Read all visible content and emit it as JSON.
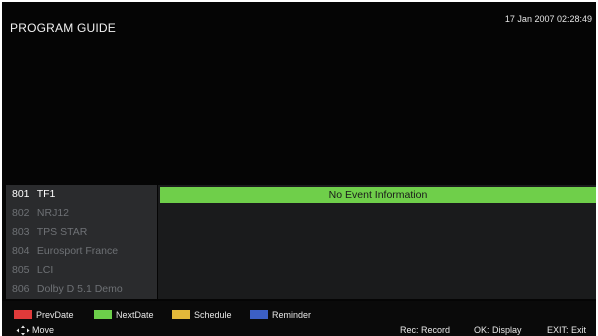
{
  "header": {
    "title": "PROGRAM GUIDE",
    "datetime": "17 Jan 2007 02:28:49"
  },
  "channels": [
    {
      "number": "801",
      "name": "TF1",
      "selected": true
    },
    {
      "number": "802",
      "name": "NRJ12",
      "selected": false
    },
    {
      "number": "803",
      "name": "TPS STAR",
      "selected": false
    },
    {
      "number": "804",
      "name": "Eurosport France",
      "selected": false
    },
    {
      "number": "805",
      "name": "LCI",
      "selected": false
    },
    {
      "number": "806",
      "name": "Dolby D 5.1 Demo",
      "selected": false
    }
  ],
  "event": {
    "text": "No Event Information"
  },
  "color_keys": [
    {
      "label": "PrevDate",
      "color": "#e03a3a"
    },
    {
      "label": "NextDate",
      "color": "#6ccf4a"
    },
    {
      "label": "Schedule",
      "color": "#e2b83a"
    },
    {
      "label": "Reminder",
      "color": "#3c5fc4"
    }
  ],
  "hints": {
    "move": "Move",
    "record": "Rec: Record",
    "display": "OK: Display",
    "exit": "EXIT: Exit"
  },
  "colors": {
    "background": "#050505",
    "channel_panel": "#2a2b2d",
    "event_highlight": "#6fcf4a",
    "selected_text": "#ffffff",
    "unselected_text": "#6e7175"
  }
}
